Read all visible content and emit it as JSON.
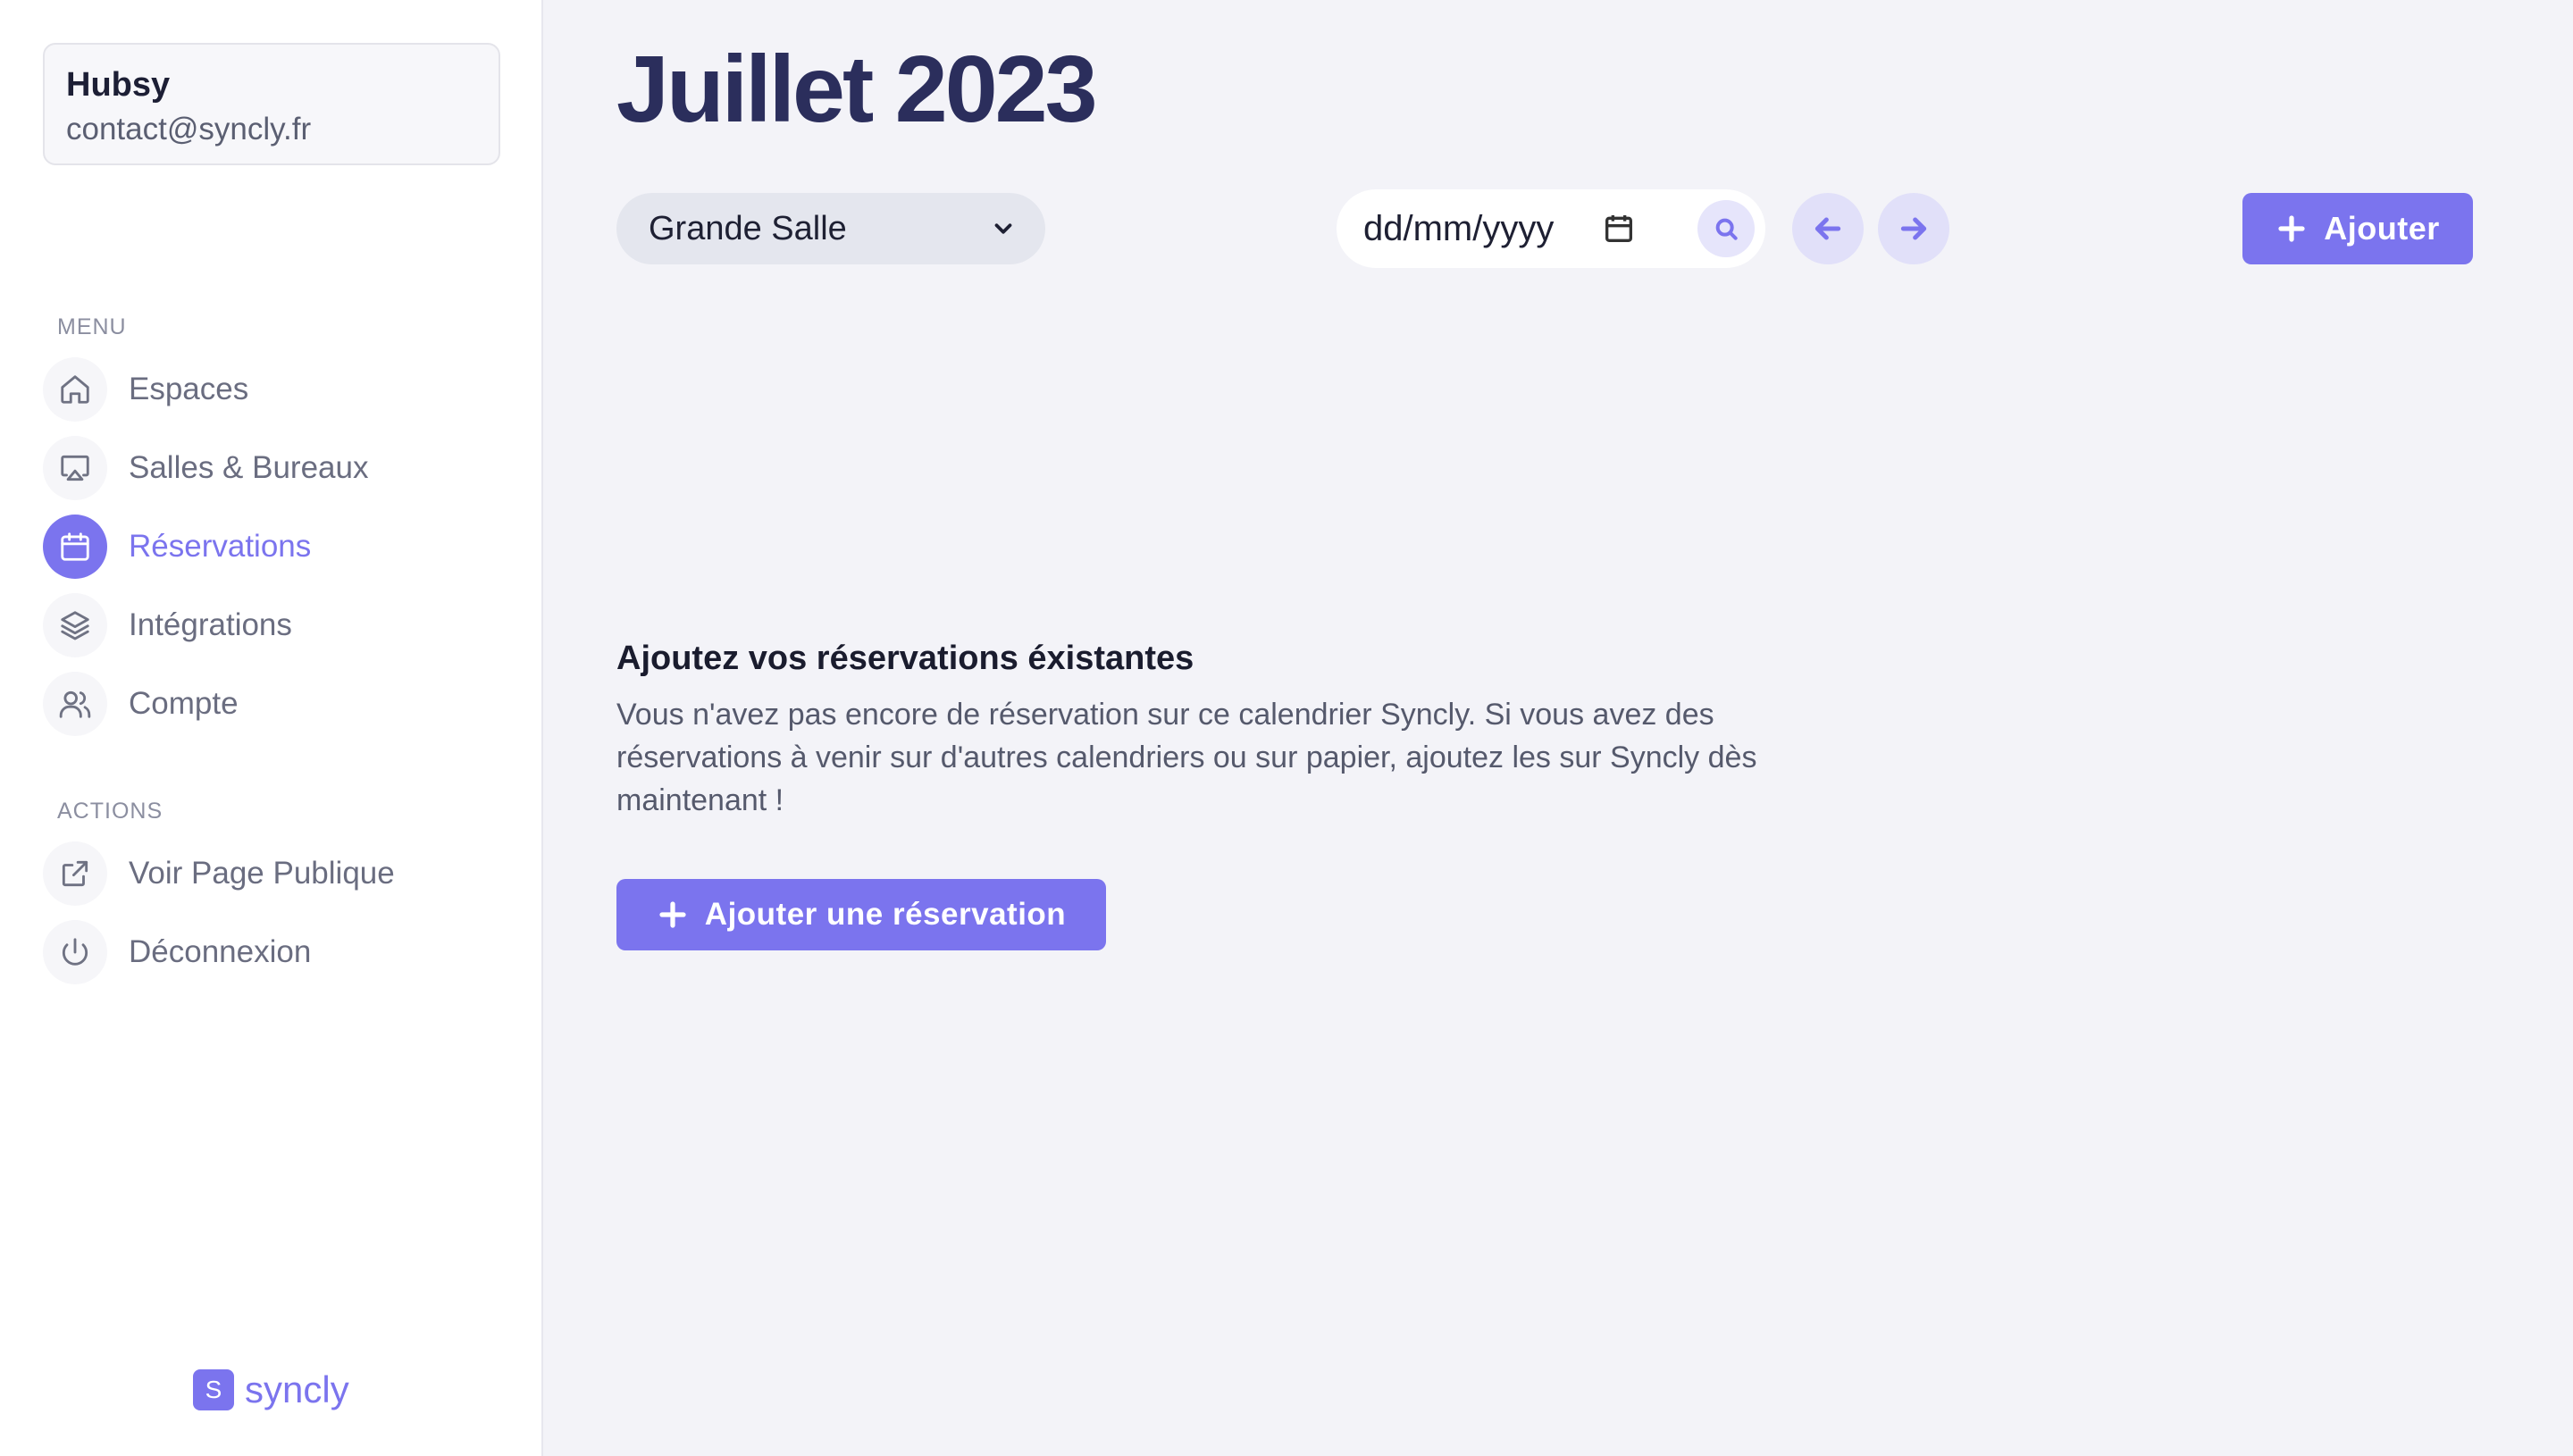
{
  "account": {
    "name": "Hubsy",
    "email": "contact@syncly.fr"
  },
  "sidebar": {
    "menu_label": "MENU",
    "menu_items": [
      {
        "label": "Espaces",
        "icon": "home-icon",
        "active": false
      },
      {
        "label": "Salles & Bureaux",
        "icon": "monitor-icon",
        "active": false
      },
      {
        "label": "Réservations",
        "icon": "calendar-icon",
        "active": true
      },
      {
        "label": "Intégrations",
        "icon": "layers-icon",
        "active": false
      },
      {
        "label": "Compte",
        "icon": "users-icon",
        "active": false
      }
    ],
    "actions_label": "ACTIONS",
    "action_items": [
      {
        "label": "Voir Page Publique",
        "icon": "external-link-icon"
      },
      {
        "label": "Déconnexion",
        "icon": "power-icon"
      }
    ]
  },
  "brand": {
    "badge": "S",
    "name": "syncly"
  },
  "main": {
    "title": "Juillet 2023",
    "room_select": {
      "value": "Grande Salle"
    },
    "date_input": {
      "placeholder": "dd/mm/yyyy",
      "value": ""
    },
    "add_button_label": "Ajouter"
  },
  "empty_state": {
    "title": "Ajoutez vos réservations éxistantes",
    "text": "Vous n'avez pas encore de réservation sur ce calendrier Syncly. Si vous avez des réservations à venir sur d'autres calendriers ou sur papier, ajoutez les sur Syncly dès maintenant !",
    "cta_label": "Ajouter une réservation"
  },
  "colors": {
    "accent": "#7b74ee",
    "title": "#2b2e5c",
    "background": "#f3f3f8"
  }
}
